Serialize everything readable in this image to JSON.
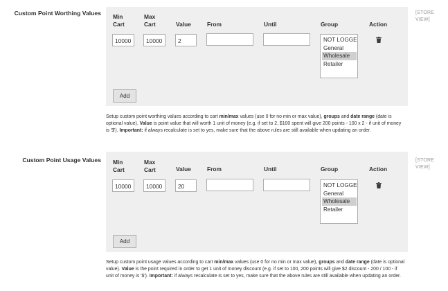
{
  "sections": [
    {
      "label": "Custom Point Worthing Values",
      "scope": [
        "[STORE",
        "VIEW]"
      ],
      "headers": {
        "min1": "Min",
        "min2": "Cart",
        "max1": "Max",
        "max2": "Cart",
        "value": "Value",
        "from": "From",
        "until": "Until",
        "group": "Group",
        "action": "Action"
      },
      "row": {
        "min_cart": "10000",
        "max_cart": "10000",
        "value": "2",
        "from": "",
        "until": ""
      },
      "groups": [
        "NOT LOGGED IN",
        "General",
        "Wholesale",
        "Retailer"
      ],
      "selected_group": "Wholesale",
      "add_label": "Add",
      "note": {
        "p1": "Setup custom point worthing values according to cart ",
        "b1": "min/max",
        "p2": " values (use 0 for no min or max value), ",
        "b2": "groups",
        "p3": " and ",
        "b3": "date range",
        "p4": " (date is optional value). ",
        "b4": "Value",
        "p5": " is point value that will worth 1 unit of money (e.g. if set to 2, $100 spent will give 200 points - 100 x 2 - if unit of money is '$'). ",
        "b5": "Important:",
        "p6": " if always recalculate is set to yes, make sure that the above rules are still available when updating an order."
      }
    },
    {
      "label": "Custom Point Usage Values",
      "scope": [
        "[STORE",
        "VIEW]"
      ],
      "headers": {
        "min1": "Min",
        "min2": "Cart",
        "max1": "Max",
        "max2": "Cart",
        "value": "Value",
        "from": "From",
        "until": "Until",
        "group": "Group",
        "action": "Action"
      },
      "row": {
        "min_cart": "10000",
        "max_cart": "10000",
        "value": "20",
        "from": "",
        "until": ""
      },
      "groups": [
        "NOT LOGGED IN",
        "General",
        "Wholesale",
        "Retailer"
      ],
      "selected_group": "Wholesale",
      "add_label": "Add",
      "note": {
        "p1": "Setup custom point usage values according to cart ",
        "b1": "min/max",
        "p2": " values (use 0 for no min or max value), ",
        "b2": "groups",
        "p3": " and ",
        "b3": "date range",
        "p4": " (date is optional value). ",
        "b4": "Value",
        "p5": " is the point required in order to get 1 unit of money discount (e.g. if set to 100, 200 points will give $2 discount - 200 / 100 - if unit of money is '$'). ",
        "b5": "Important:",
        "p6": " if always recalculate is set to yes, make sure that the above rules are still available when updating an order."
      }
    }
  ],
  "icons": {
    "delete": "trash-icon"
  },
  "colors": {
    "panel_bg": "#efefef",
    "selected_option": "#cfcfcf",
    "text": "#303030",
    "scope": "#999999"
  }
}
